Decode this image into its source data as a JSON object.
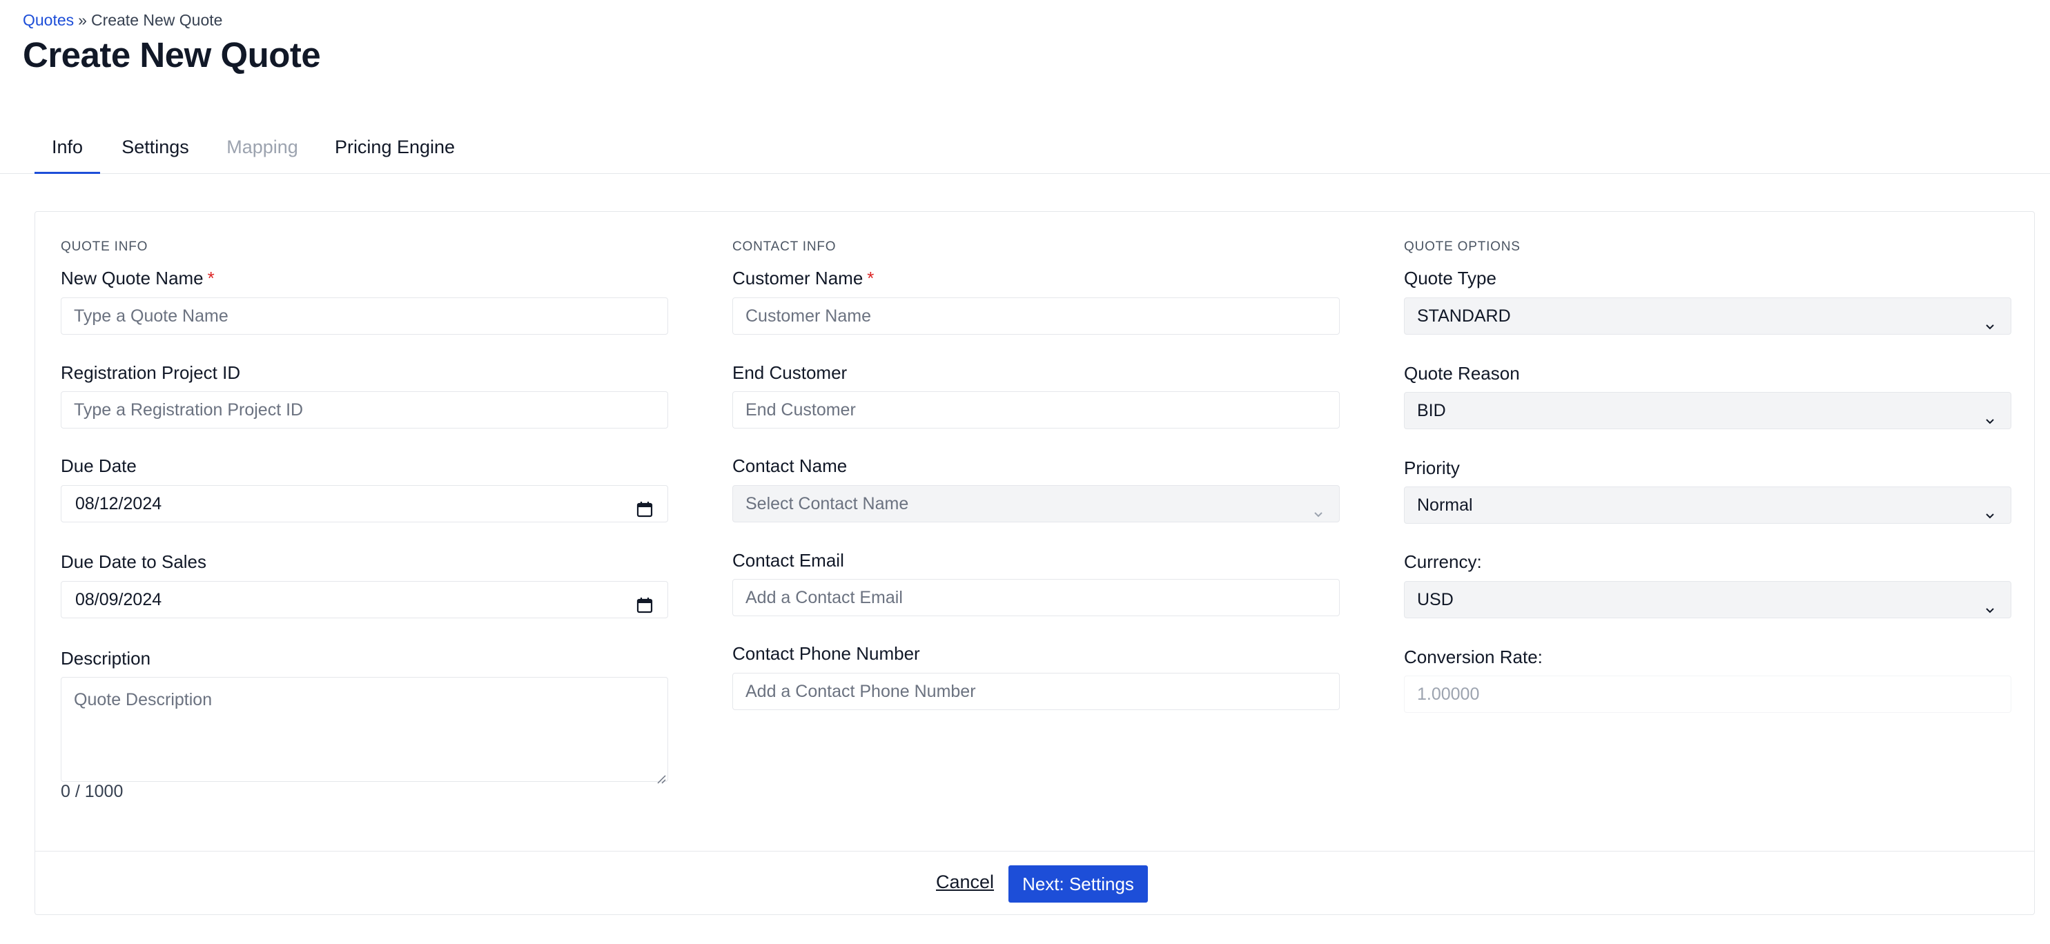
{
  "breadcrumb": {
    "root": "Quotes",
    "separator": "»",
    "current": "Create New Quote"
  },
  "page_title": "Create New Quote",
  "tabs": [
    {
      "label": "Info",
      "state": "active"
    },
    {
      "label": "Settings",
      "state": "enabled"
    },
    {
      "label": "Mapping",
      "state": "disabled"
    },
    {
      "label": "Pricing Engine",
      "state": "enabled"
    }
  ],
  "quote_info": {
    "section_title": "QUOTE INFO",
    "quote_name": {
      "label": "New Quote Name",
      "required": "*",
      "value": "",
      "placeholder": "Type a Quote Name"
    },
    "registration_id": {
      "label": "Registration Project ID",
      "value": "",
      "placeholder": "Type a Registration Project ID"
    },
    "due_date": {
      "label": "Due Date",
      "value": "08/12/2024"
    },
    "due_date_sales": {
      "label": "Due Date to Sales",
      "value": "08/09/2024"
    },
    "description": {
      "label": "Description",
      "placeholder": "Quote Description",
      "counter": "0 / 1000"
    }
  },
  "contact_info": {
    "section_title": "CONTACT INFO",
    "customer_name": {
      "label": "Customer Name",
      "required": "*",
      "value": "",
      "placeholder": "Customer Name"
    },
    "end_customer": {
      "label": "End Customer",
      "value": "",
      "placeholder": "End Customer"
    },
    "contact_name": {
      "label": "Contact Name",
      "placeholder": "Select Contact Name"
    },
    "contact_email": {
      "label": "Contact Email",
      "value": "",
      "placeholder": "Add a Contact Email"
    },
    "contact_phone": {
      "label": "Contact Phone Number",
      "value": "",
      "placeholder": "Add a Contact Phone Number"
    }
  },
  "quote_options": {
    "section_title": "QUOTE OPTIONS",
    "quote_type": {
      "label": "Quote Type",
      "value": "STANDARD"
    },
    "quote_reason": {
      "label": "Quote Reason",
      "value": "BID"
    },
    "priority": {
      "label": "Priority",
      "value": "Normal"
    },
    "currency": {
      "label": "Currency:",
      "value": "USD"
    },
    "conversion_rate": {
      "label": "Conversion Rate:",
      "value": "1.00000"
    }
  },
  "footer": {
    "cancel_label": "Cancel",
    "next_label": "Next: Settings"
  },
  "colors": {
    "accent": "#1d4ed8",
    "required": "#dc2626",
    "border": "#e5e7eb",
    "select_bg": "#f3f4f6"
  },
  "icons": {
    "date": "calendar-icon",
    "select": "chevron-down-icon",
    "textarea": "resize-handle-icon"
  }
}
